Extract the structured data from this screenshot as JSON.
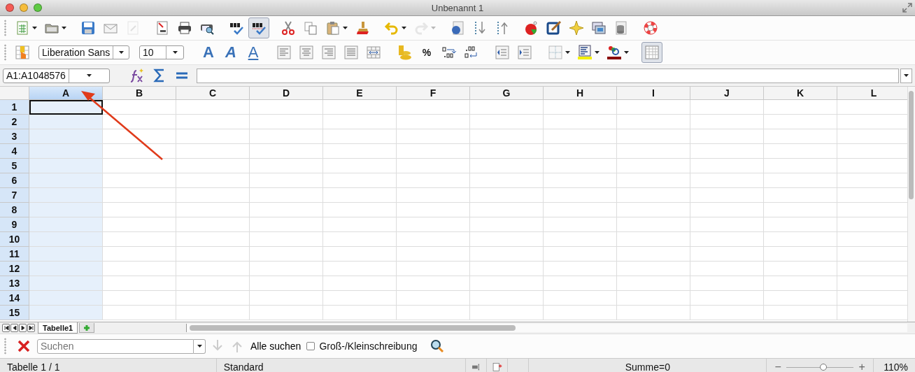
{
  "window": {
    "title": "Unbenannt 1"
  },
  "standard_toolbar": [
    {
      "pressed": false,
      "dropdown": true,
      "disabled": false
    },
    {
      "pressed": false,
      "dropdown": true,
      "disabled": false
    },
    {
      "pressed": false,
      "dropdown": false,
      "disabled": false
    },
    {
      "pressed": false,
      "dropdown": false,
      "disabled": false
    },
    {
      "pressed": false,
      "dropdown": false,
      "disabled": true
    },
    {
      "pressed": false,
      "dropdown": false,
      "disabled": false
    },
    {
      "pressed": false,
      "dropdown": false,
      "disabled": false
    },
    {
      "pressed": false,
      "dropdown": false,
      "disabled": false
    },
    {
      "pressed": false,
      "dropdown": false,
      "disabled": false
    },
    {
      "pressed": true,
      "dropdown": false,
      "disabled": false
    },
    {
      "pressed": false,
      "dropdown": false,
      "disabled": false
    },
    {
      "pressed": false,
      "dropdown": false,
      "disabled": false
    },
    {
      "pressed": false,
      "dropdown": true,
      "disabled": false
    },
    {
      "pressed": false,
      "dropdown": false,
      "disabled": false
    },
    {
      "pressed": false,
      "dropdown": true,
      "disabled": false
    },
    {
      "pressed": false,
      "dropdown": true,
      "disabled": true
    },
    {
      "pressed": false,
      "dropdown": false,
      "disabled": false
    },
    {
      "pressed": false,
      "dropdown": false,
      "disabled": false
    },
    {
      "pressed": false,
      "dropdown": false,
      "disabled": false
    },
    {
      "pressed": false,
      "dropdown": false,
      "disabled": false
    },
    {
      "pressed": false,
      "dropdown": false,
      "disabled": false
    },
    {
      "pressed": false,
      "dropdown": false,
      "disabled": false
    },
    {
      "pressed": false,
      "dropdown": false,
      "disabled": false
    },
    {
      "pressed": false,
      "dropdown": false,
      "disabled": false
    },
    {
      "pressed": false,
      "dropdown": false,
      "disabled": false
    }
  ],
  "formatting_toolbar": [
    {
      "kind": "button",
      "pressed": false,
      "dropdown": false
    },
    {
      "kind": "font-name",
      "value": "Liberation Sans"
    },
    {
      "kind": "font-size",
      "value": "10"
    },
    {
      "kind": "button",
      "label": "A",
      "pressed": false,
      "dropdown": false
    },
    {
      "kind": "button",
      "label": "A",
      "pressed": false,
      "dropdown": false
    },
    {
      "kind": "button",
      "label": "A",
      "pressed": false,
      "dropdown": false
    },
    {
      "kind": "button",
      "pressed": false,
      "dropdown": false
    },
    {
      "kind": "button",
      "pressed": false,
      "dropdown": false
    },
    {
      "kind": "button",
      "pressed": false,
      "dropdown": false
    },
    {
      "kind": "button",
      "pressed": false,
      "dropdown": false
    },
    {
      "kind": "button",
      "pressed": false,
      "dropdown": false
    },
    {
      "kind": "button",
      "pressed": false,
      "dropdown": false
    },
    {
      "kind": "button",
      "label": "%",
      "pressed": false,
      "dropdown": false
    },
    {
      "kind": "button",
      "pressed": false,
      "dropdown": false
    },
    {
      "kind": "button",
      "pressed": false,
      "dropdown": false
    },
    {
      "kind": "button",
      "pressed": false,
      "dropdown": false
    },
    {
      "kind": "button",
      "pressed": false,
      "dropdown": false
    },
    {
      "kind": "button",
      "pressed": false,
      "dropdown": true
    },
    {
      "kind": "button",
      "pressed": false,
      "dropdown": true
    },
    {
      "kind": "button",
      "pressed": false,
      "dropdown": true
    },
    {
      "kind": "button",
      "pressed": true,
      "dropdown": false
    }
  ],
  "formula_bar": {
    "name_box": "A1:A1048576"
  },
  "sheet": {
    "columns": [
      {
        "label": "A",
        "selected": true
      },
      {
        "label": "B",
        "selected": false
      },
      {
        "label": "C",
        "selected": false
      },
      {
        "label": "D",
        "selected": false
      },
      {
        "label": "E",
        "selected": false
      },
      {
        "label": "F",
        "selected": false
      },
      {
        "label": "G",
        "selected": false
      },
      {
        "label": "H",
        "selected": false
      },
      {
        "label": "I",
        "selected": false
      },
      {
        "label": "J",
        "selected": false
      },
      {
        "label": "K",
        "selected": false
      },
      {
        "label": "L",
        "selected": false
      }
    ],
    "rows": [
      {
        "label": "1",
        "selected": true
      },
      {
        "label": "2",
        "selected": true
      },
      {
        "label": "3",
        "selected": true
      },
      {
        "label": "4",
        "selected": true
      },
      {
        "label": "5",
        "selected": true
      },
      {
        "label": "6",
        "selected": true
      },
      {
        "label": "7",
        "selected": true
      },
      {
        "label": "8",
        "selected": true
      },
      {
        "label": "9",
        "selected": true
      },
      {
        "label": "10",
        "selected": true
      },
      {
        "label": "11",
        "selected": true
      },
      {
        "label": "12",
        "selected": true
      },
      {
        "label": "13",
        "selected": true
      },
      {
        "label": "14",
        "selected": true
      },
      {
        "label": "15",
        "selected": true
      }
    ]
  },
  "sheet_tabs": [
    {
      "label": "Tabelle1",
      "selected": true
    }
  ],
  "find_bar": {
    "placeholder": "Suchen",
    "find_all": "Alle suchen",
    "match_case": {
      "label": "Groß-/Kleinschreibung",
      "checked": false
    }
  },
  "status_bar": {
    "sheet": "Tabelle 1 / 1",
    "page_style": "Standard",
    "sum": "Summe=0",
    "zoom": {
      "zoom_out": "−",
      "level": 0.55,
      "zoom_in": "+",
      "reading": "110%"
    }
  }
}
